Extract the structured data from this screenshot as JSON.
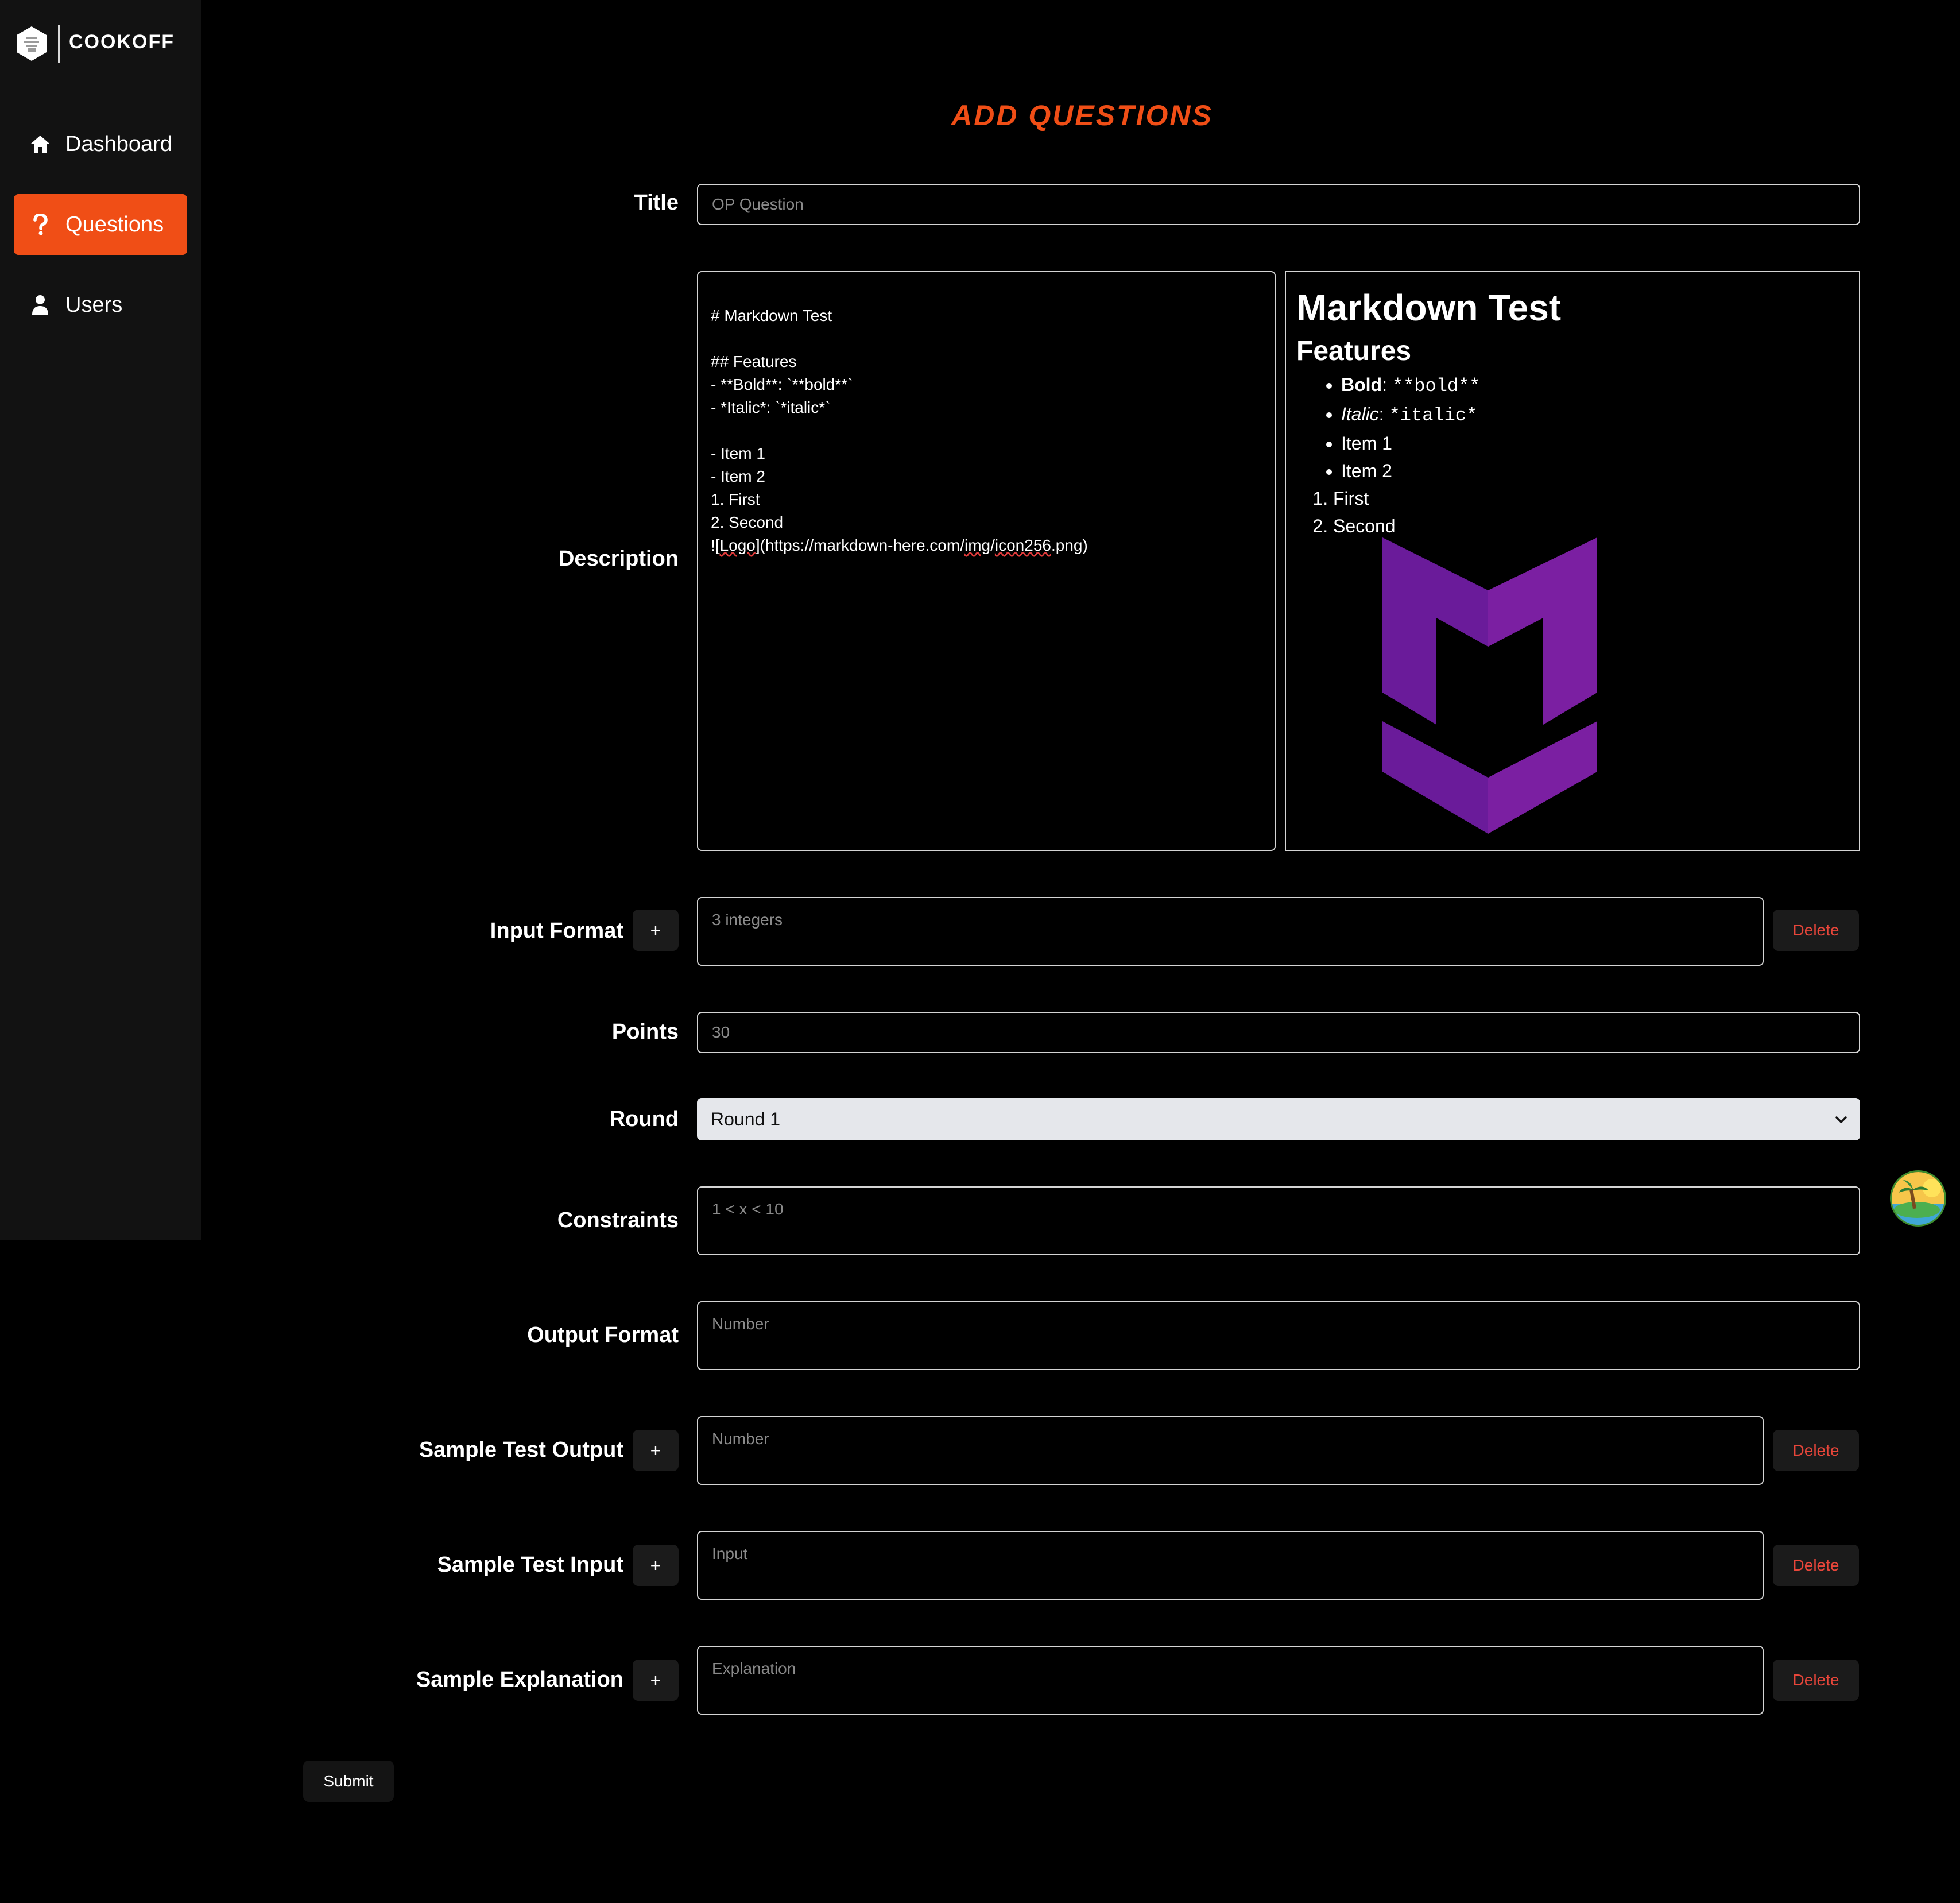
{
  "brand": {
    "name": "COOKOFF"
  },
  "sidebar": {
    "items": [
      {
        "label": "Dashboard",
        "icon": "home-icon",
        "active": false
      },
      {
        "label": "Questions",
        "icon": "question-icon",
        "active": true
      },
      {
        "label": "Users",
        "icon": "user-icon",
        "active": false
      }
    ]
  },
  "page": {
    "title": "ADD QUESTIONS"
  },
  "form": {
    "title": {
      "label": "Title",
      "placeholder": "OP Question"
    },
    "description": {
      "label": "Description",
      "editor_lines": [
        "# Markdown Test",
        "",
        "## Features",
        "- **Bold**: `**bold**`",
        "- *Italic*: `*italic*`",
        "",
        "- Item 1",
        "- Item 2",
        "1. First",
        "2. Second",
        "![Logo](https://markdown-here.com/img/icon256.png)"
      ],
      "preview": {
        "h1": "Markdown Test",
        "h2": "Features",
        "bullets": [
          {
            "strong": "Bold",
            "sep": ": ",
            "code": "**bold**"
          },
          {
            "em": "Italic",
            "sep": ": ",
            "code": "*italic*"
          },
          {
            "text": "Item 1"
          },
          {
            "text": "Item 2"
          }
        ],
        "ordered": [
          "First",
          "Second"
        ],
        "image_alt": "Logo"
      }
    },
    "input_format": {
      "label": "Input Format",
      "placeholder": "3 integers",
      "add": "+",
      "delete": "Delete"
    },
    "points": {
      "label": "Points",
      "placeholder": "30"
    },
    "round": {
      "label": "Round",
      "value": "Round 1"
    },
    "constraints": {
      "label": "Constraints",
      "placeholder": "1 < x < 10"
    },
    "output_format": {
      "label": "Output Format",
      "placeholder": "Number"
    },
    "sample_test_output": {
      "label": "Sample Test Output",
      "placeholder": "Number",
      "add": "+",
      "delete": "Delete"
    },
    "sample_test_input": {
      "label": "Sample Test Input",
      "placeholder": "Input",
      "add": "+",
      "delete": "Delete"
    },
    "sample_explanation": {
      "label": "Sample Explanation",
      "placeholder": "Explanation",
      "add": "+",
      "delete": "Delete"
    },
    "submit": "Submit"
  },
  "colors": {
    "accent": "#f04e16",
    "sidebar_bg": "#121212",
    "delete_text": "#e8463a",
    "logo_purple": "#7b1fa2"
  }
}
